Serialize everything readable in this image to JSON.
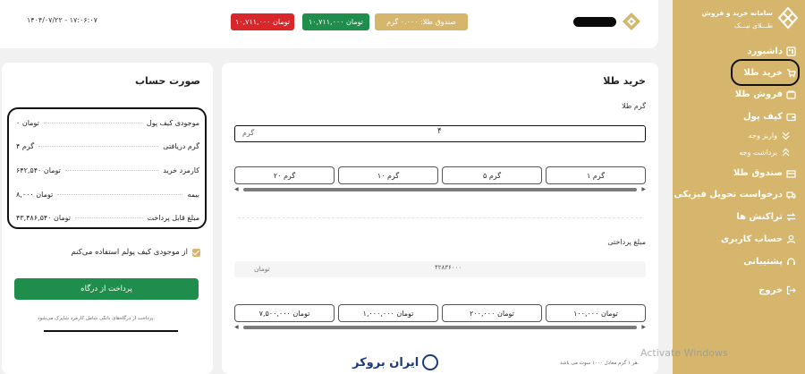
{
  "sidebar": {
    "brand_title": "سامانه خرید و فروش",
    "brand_sub": "طـــلای نیـــک",
    "items": [
      {
        "label": "داشبورد",
        "icon": "dashboard-icon"
      },
      {
        "label": "خرید طلا",
        "icon": "cart-icon",
        "active": true
      },
      {
        "label": "فروش طلا",
        "icon": "sell-icon"
      },
      {
        "label": "کیف پول",
        "icon": "wallet-icon"
      },
      {
        "label": "واریز وجه",
        "icon": "deposit-icon"
      },
      {
        "label": "برداشت وجه",
        "icon": "withdraw-icon"
      },
      {
        "label": "صندوق طلا",
        "icon": "gold-box-icon"
      },
      {
        "label": "درخواست تحویل فیزیکی",
        "icon": "delivery-icon"
      },
      {
        "label": "تراکنش ها",
        "icon": "transactions-icon"
      },
      {
        "label": "حساب کاربری",
        "icon": "user-icon"
      },
      {
        "label": "پشتیبانی",
        "icon": "support-icon"
      },
      {
        "label": "خروج",
        "icon": "logout-icon"
      }
    ]
  },
  "header": {
    "datetime": "۱۴۰۴/۰۷/۲۲ - ۱۷:۰۶:۰۷",
    "balance_red": "۱۰,۷۱۱,۰۰۰ تومان",
    "balance_green": "۱۰,۷۱۱,۰۰۰ تومان",
    "gold_box": "صندوق طلا: ۰.۰۰۰ گرم"
  },
  "invoice": {
    "title": "صورت حساب",
    "rows": [
      {
        "label": "موجودی کیف پول",
        "value": "۰ تومان"
      },
      {
        "label": "گرم دریافتی",
        "value": "۴ گرم"
      },
      {
        "label": "کارمزد خرید",
        "value": "۶۴۲,۵۴۰ تومان"
      },
      {
        "label": "بیمه",
        "value": "۸,۰۰۰ تومان"
      },
      {
        "label": "مبلغ قابل پرداخت",
        "value": "۴۳,۴۸۶,۵۴۰ تومان"
      }
    ],
    "wallet_checkbox_label": "از موجودی کیف پولم استفاده می‌کنم",
    "pay_button": "پرداخت از درگاه",
    "pay_note": "پرداخت از درگاه‌های بانکی شامل کارمزد شاپرک می‌شود."
  },
  "buy": {
    "title": "خرید طلا",
    "gram_label": "گرم طلا",
    "gram_unit": "گرم",
    "gram_value": "۴",
    "gram_buttons": [
      "۱ گرم",
      "۵ گرم",
      "۱۰ گرم",
      "۲۰ گرم"
    ],
    "amount_label": "مبلغ پرداختی",
    "amount_value": "۴۲۸۳۶۰۰۰",
    "amount_unit": "تومان",
    "amount_buttons": [
      "۱۰۰,۰۰۰ تومان",
      "۲۰۰,۰۰۰ تومان",
      "۱,۰۰۰,۰۰۰ تومان",
      "۷,۵۰۰,۰۰۰ تومان"
    ],
    "footnote": "هر ۱ گرم معادل ۱۰۰۰ سوت می باشد."
  },
  "watermark": {
    "brand": "ایران بروکر",
    "activate": "Activate Windows"
  },
  "colors": {
    "gold": "#d6b66d",
    "green": "#1f8d4b",
    "red": "#d9262b"
  }
}
